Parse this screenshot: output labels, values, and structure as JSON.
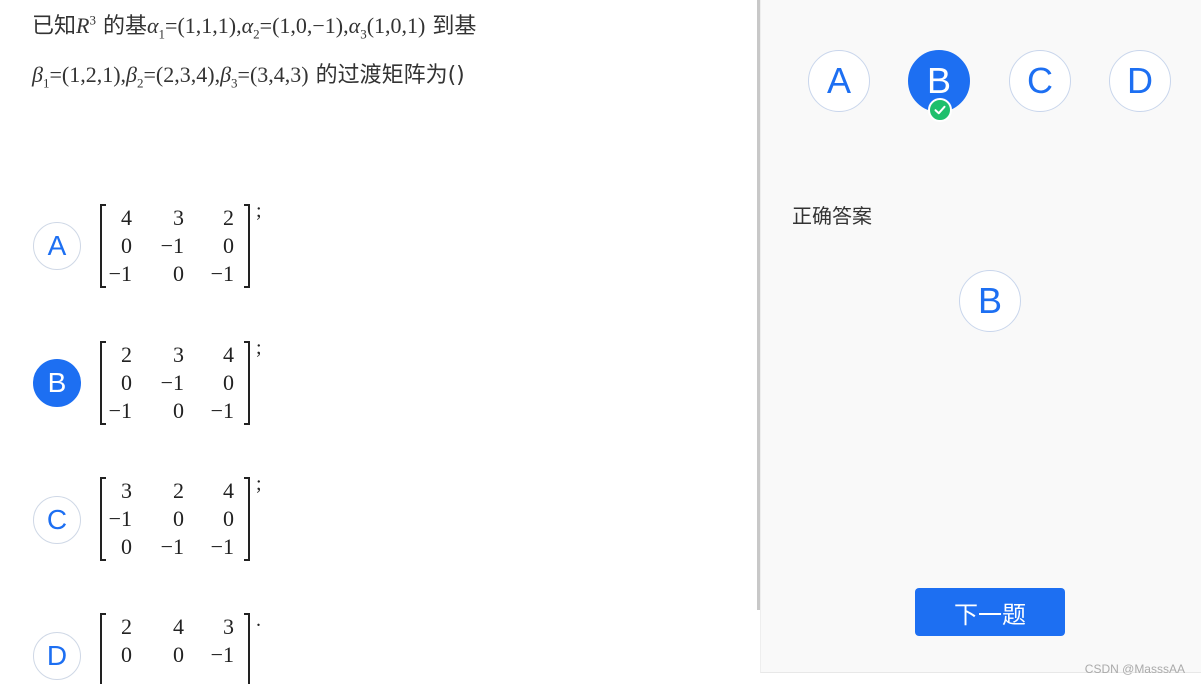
{
  "question": {
    "line1": {
      "t1": "已知",
      "R": "R",
      "R_exp": "3",
      "t2": " 的基",
      "a1_sym": "α",
      "a1_sub": "1",
      "a1_val": "=(1,1,1)",
      "a2_sym": "α",
      "a2_sub": "2",
      "a2_val": "=(1,0,−1)",
      "a3_sym": "α",
      "a3_sub": "3",
      "a3_val": "(1,0,1)",
      "sep": ",",
      "t3": " 到基"
    },
    "line2": {
      "b1_sym": "β",
      "b1_sub": "1",
      "b1_val": "=(1,2,1)",
      "b2_sym": "β",
      "b2_sub": "2",
      "b2_val": "=(2,3,4)",
      "b3_sym": "β",
      "b3_sub": "3",
      "b3_val": "=(3,4,3)",
      "sep": ",",
      "t4": " 的过渡矩阵为()"
    }
  },
  "options": [
    {
      "letter": "A",
      "selected": false,
      "punct": ";",
      "rows": [
        [
          "4",
          "3",
          "2"
        ],
        [
          "0",
          "−1",
          "0"
        ],
        [
          "−1",
          "0",
          "−1"
        ]
      ]
    },
    {
      "letter": "B",
      "selected": true,
      "punct": ";",
      "rows": [
        [
          "2",
          "3",
          "4"
        ],
        [
          "0",
          "−1",
          "0"
        ],
        [
          "−1",
          "0",
          "−1"
        ]
      ]
    },
    {
      "letter": "C",
      "selected": false,
      "punct": ";",
      "rows": [
        [
          "3",
          "2",
          "4"
        ],
        [
          "−1",
          "0",
          "0"
        ],
        [
          "0",
          "−1",
          "−1"
        ]
      ]
    },
    {
      "letter": "D",
      "selected": false,
      "punct": ".",
      "rows": [
        [
          "2",
          "4",
          "3"
        ],
        [
          "0",
          "0",
          "−1"
        ],
        [
          "",
          "",
          ""
        ]
      ]
    }
  ],
  "panel": {
    "choices": [
      {
        "letter": "A",
        "selected": false
      },
      {
        "letter": "B",
        "selected": true,
        "status_icon": "check-icon"
      },
      {
        "letter": "C",
        "selected": false
      },
      {
        "letter": "D",
        "selected": false
      }
    ],
    "answer_label": "正确答案",
    "correct_answer": "B",
    "next_button": "下一题"
  },
  "watermark": "CSDN @MasssAA",
  "colors": {
    "accent": "#1d6ff2",
    "check": "#1fbf6c"
  }
}
